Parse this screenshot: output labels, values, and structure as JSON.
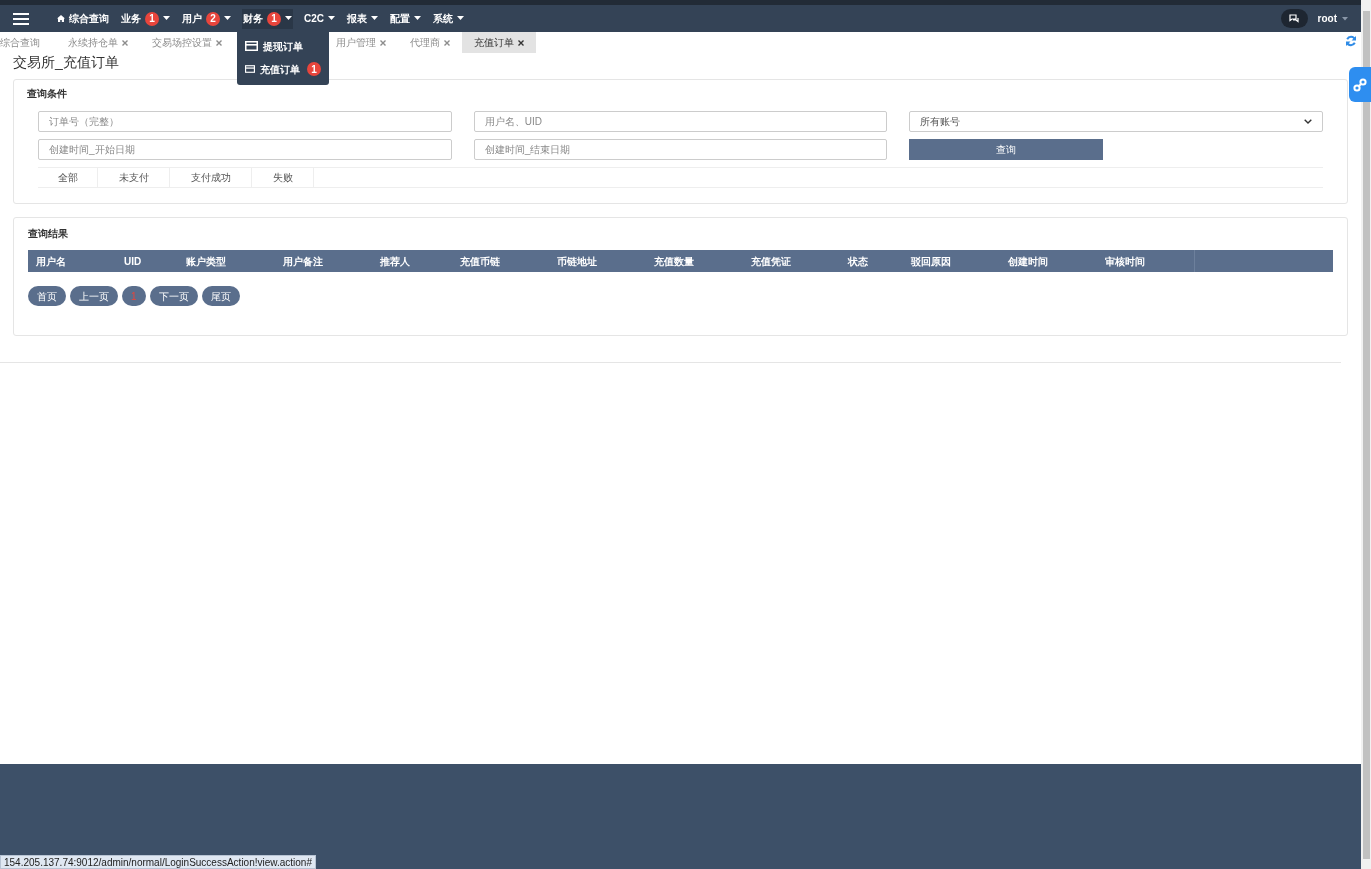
{
  "navbar": {
    "menu": [
      {
        "label": "综合查询",
        "kind": "home",
        "dropdown": false
      },
      {
        "label": "业务",
        "badge": "1",
        "dropdown": true,
        "expanded": false
      },
      {
        "label": "用户",
        "badge": "2",
        "dropdown": true,
        "expanded": false
      },
      {
        "label": "财务",
        "badge": "1",
        "dropdown": true,
        "expanded": true
      },
      {
        "label": "C2C",
        "dropdown": true,
        "expanded": false
      },
      {
        "label": "报表",
        "dropdown": true,
        "expanded": false
      },
      {
        "label": "配置",
        "dropdown": true,
        "expanded": false
      },
      {
        "label": "系统",
        "dropdown": true,
        "expanded": false
      }
    ],
    "user": "root"
  },
  "dropdown_menu": [
    {
      "label": "提现订单"
    },
    {
      "label": "充值订单",
      "badge": "1"
    }
  ],
  "open_tabs": [
    {
      "label": "综合查询",
      "closable": false,
      "selected": false
    },
    {
      "label": "永续持仓单",
      "closable": true,
      "selected": false
    },
    {
      "label": "交易场控设置",
      "closable": true,
      "selected": false
    },
    {
      "label": "用户管理",
      "closable": true,
      "selected": false
    },
    {
      "label": "代理商",
      "closable": true,
      "selected": false
    },
    {
      "label": "充值订单",
      "closable": true,
      "selected": true
    }
  ],
  "page_title": "交易所_充值订单",
  "query_panel": {
    "title": "查询条件",
    "fields": [
      {
        "placeholder": "订单号（完整）",
        "kind": "input"
      },
      {
        "placeholder": "用户名、UID",
        "kind": "input"
      },
      {
        "value": "所有账号",
        "kind": "select"
      },
      {
        "placeholder": "创建时间_开始日期",
        "kind": "input"
      },
      {
        "placeholder": "创建时间_结束日期",
        "kind": "input"
      }
    ],
    "search_button": "查询",
    "status_tabs": [
      {
        "label": "全部",
        "selected": false
      },
      {
        "label": "未支付",
        "selected": false
      },
      {
        "label": "支付成功",
        "selected": false
      },
      {
        "label": "失败",
        "selected": false
      }
    ]
  },
  "result_panel": {
    "title": "查询结果",
    "columns": [
      "用户名",
      "UID",
      "账户类型",
      "用户备注",
      "推荐人",
      "充值币链",
      "币链地址",
      "充值数量",
      "充值凭证",
      "状态",
      "驳回原因",
      "创建时间",
      "审核时间"
    ],
    "pagination": [
      {
        "label": "首页",
        "current": false
      },
      {
        "label": "上一页",
        "current": false
      },
      {
        "label": "1",
        "current": true
      },
      {
        "label": "下一页",
        "current": false
      },
      {
        "label": "尾页",
        "current": false
      }
    ]
  },
  "status_url": "154.205.137.74:9012/admin/normal/LoginSuccessAction!view.action#"
}
